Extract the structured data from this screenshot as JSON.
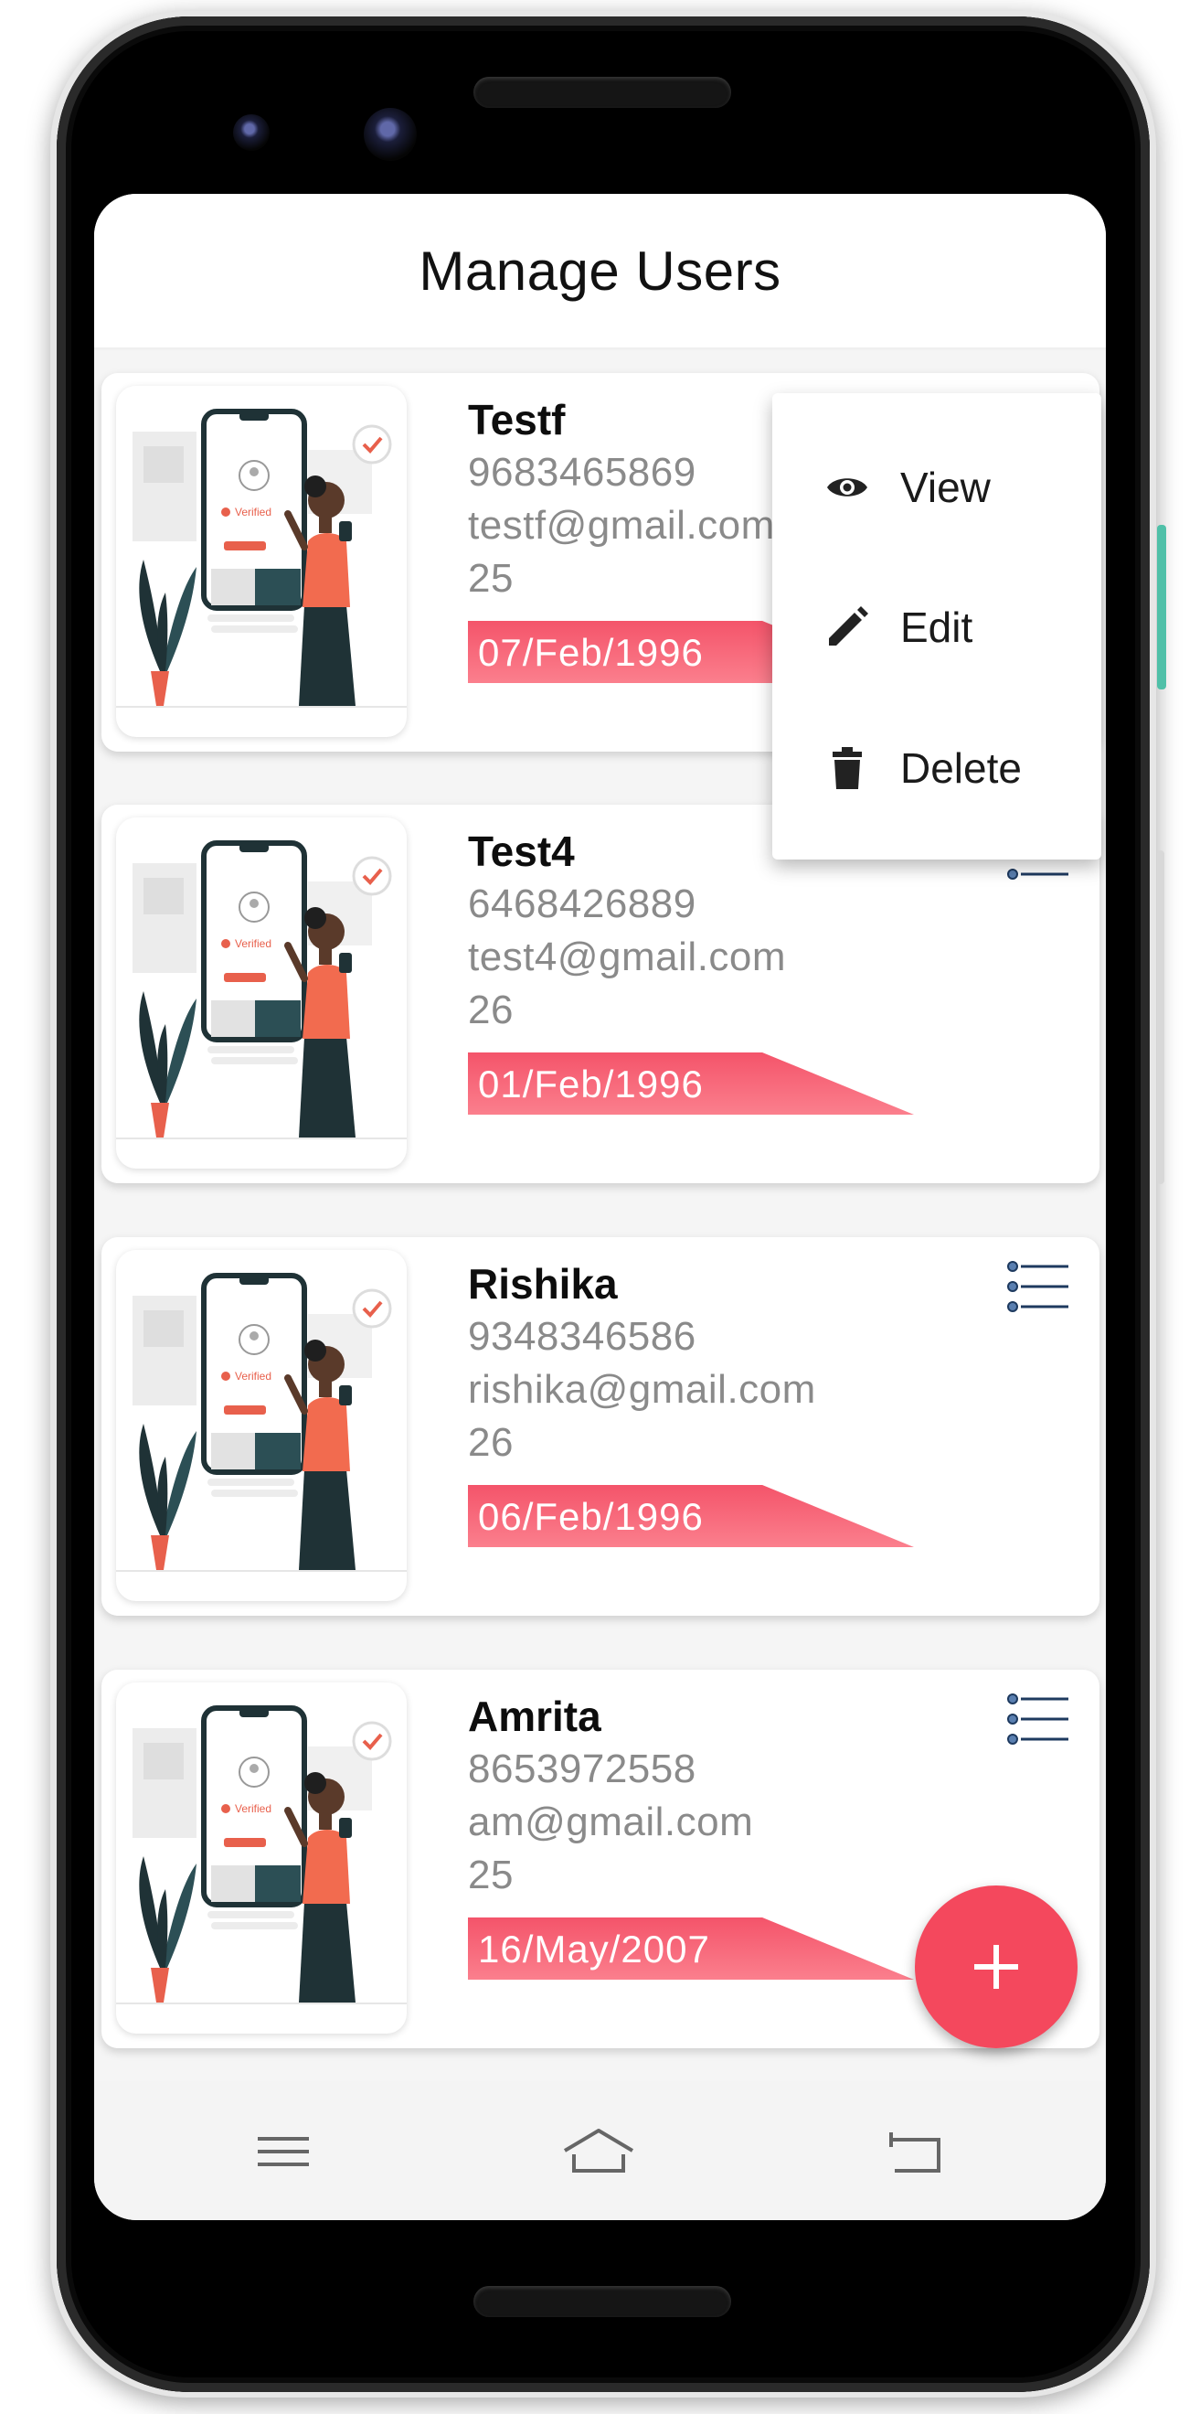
{
  "header": {
    "title": "Manage Users"
  },
  "users": [
    {
      "name": "Testf",
      "phone": "9683465869",
      "email": "testf@gmail.com",
      "age": "25",
      "dob": "07/Feb/1996",
      "avatar_caption": "Verified"
    },
    {
      "name": "Test4",
      "phone": "6468426889",
      "email": "test4@gmail.com",
      "age": "26",
      "dob": "01/Feb/1996",
      "avatar_caption": "Verified"
    },
    {
      "name": "Rishika",
      "phone": "9348346586",
      "email": "rishika@gmail.com",
      "age": "26",
      "dob": "06/Feb/1996",
      "avatar_caption": "Verified"
    },
    {
      "name": "Amrita",
      "phone": "8653972558",
      "email": "am@gmail.com",
      "age": "25",
      "dob": "16/May/2007",
      "avatar_caption": "Verified"
    }
  ],
  "popup_menu": {
    "items": [
      {
        "label": "View",
        "icon": "eye-icon"
      },
      {
        "label": "Edit",
        "icon": "pencil-icon"
      },
      {
        "label": "Delete",
        "icon": "trash-icon"
      }
    ]
  },
  "fab": {
    "icon": "plus-icon"
  },
  "nav": {
    "icons": [
      "menu-icon",
      "home-icon",
      "back-icon"
    ]
  },
  "colors": {
    "accent": "#f4485d",
    "tag_gradient_start": "#f4546a",
    "tag_gradient_end": "#fb7f8d",
    "text_primary": "#0d0d0d",
    "text_secondary": "#8a8a8a",
    "list_icon": "#1e3a5f"
  }
}
